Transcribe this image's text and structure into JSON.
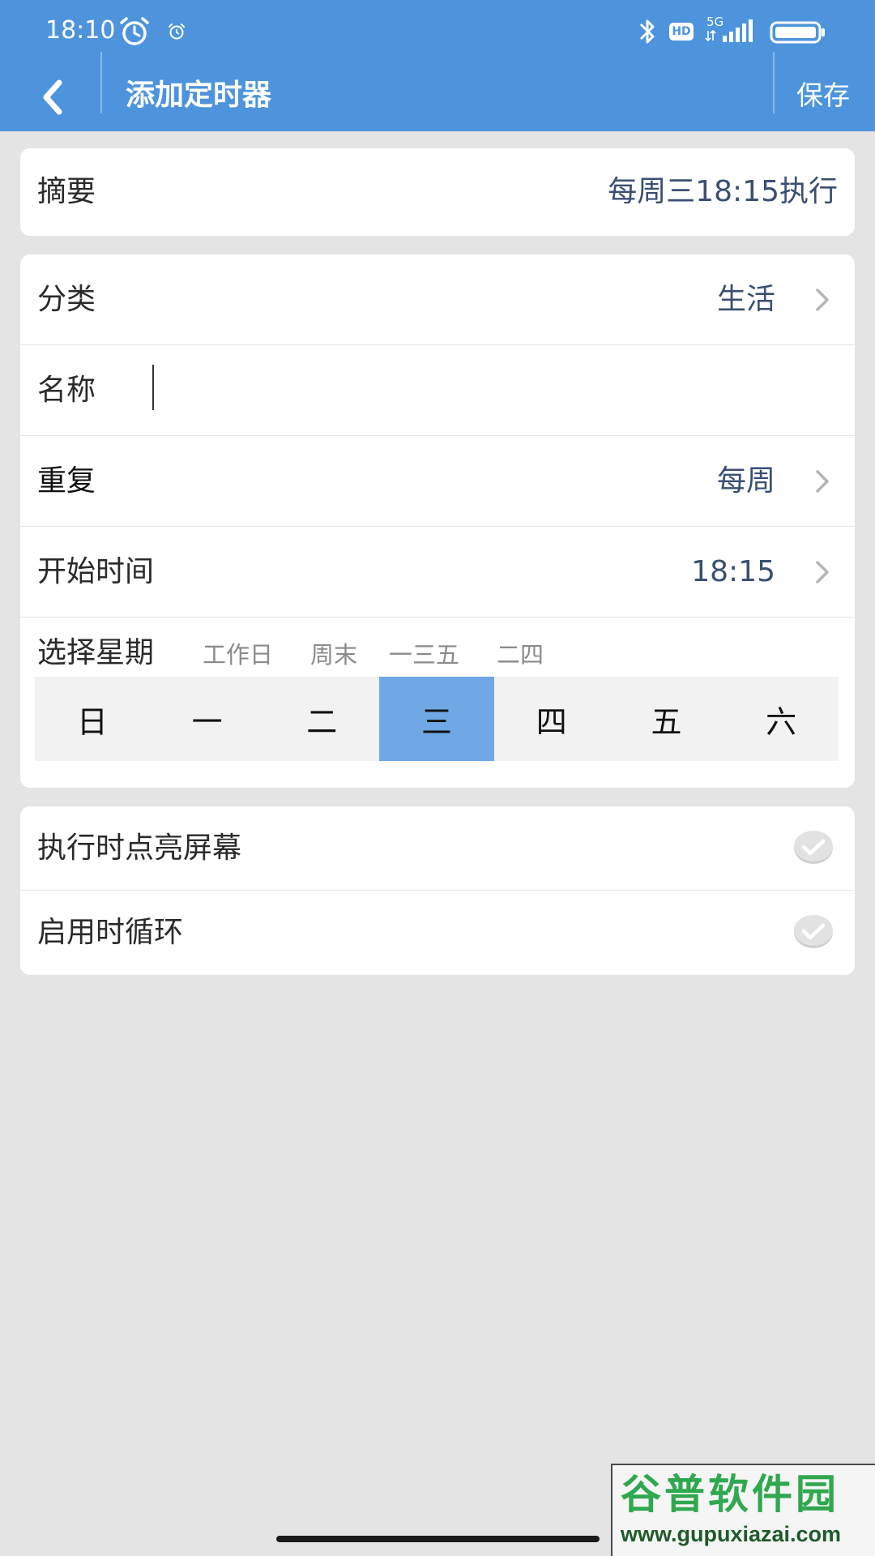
{
  "status_bar": {
    "time": "18:10",
    "network": "5G",
    "hd_badge": "HD",
    "icons": [
      "alarm-icon",
      "small-alarm-icon",
      "bluetooth-icon",
      "hd-icon",
      "signal-icon",
      "battery-icon"
    ]
  },
  "header": {
    "title": "添加定时器",
    "save_label": "保存",
    "back_icon": "chevron-left-icon",
    "bg_color": "#4d94dd"
  },
  "summary": {
    "label": "摘要",
    "value": "每周三18:15执行"
  },
  "settings": {
    "category": {
      "label": "分类",
      "value": "生活"
    },
    "name": {
      "label": "名称",
      "value": ""
    },
    "repeat": {
      "label": "重复",
      "value": "每周"
    },
    "start_time": {
      "label": "开始时间",
      "value": "18:15"
    }
  },
  "weekday_picker": {
    "label": "选择星期",
    "presets": [
      "工作日",
      "周末",
      "一三五",
      "二四"
    ],
    "days": [
      "日",
      "一",
      "二",
      "三",
      "四",
      "五",
      "六"
    ],
    "selected_day": "三",
    "selected_color": "#6fa8e4"
  },
  "toggles": {
    "wake_screen": {
      "label": "执行时点亮屏幕"
    },
    "loop_on_enable": {
      "label": "启用时循环"
    }
  },
  "watermark": {
    "title": "谷普软件园",
    "url": "www.gupuxiazai.com"
  }
}
